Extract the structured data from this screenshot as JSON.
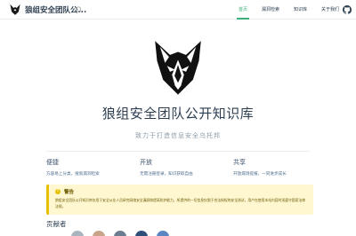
{
  "header": {
    "site_name": "狼组安全团队公...",
    "nav": [
      {
        "label": "首页",
        "active": true
      },
      {
        "label": "漏洞检索",
        "active": false
      },
      {
        "label": "知识库",
        "active": false
      },
      {
        "label": "关于我们",
        "active": false
      }
    ]
  },
  "hero": {
    "title": "狼组安全团队公开知识库",
    "description": "致力于打造信息安全乌托邦"
  },
  "features": [
    {
      "title": "便捷",
      "text": "方容易上分类，搜索漏洞检索"
    },
    {
      "title": "开放",
      "text": "无需注册登录，知识获取自由"
    },
    {
      "title": "共享",
      "text": "开放漏洞提报，一同进步成长"
    }
  ],
  "warning": {
    "icon": "!",
    "title": "警告",
    "text": "狼组安全团队公开知识库仅用于安全从业人员研究网络安全漏洞和提高防护能力，所提供的一切信息仅限于合法授权的安全测试，用户在使用本站内容时须遵守国家法律法规。"
  },
  "contributors": {
    "title": "贡献者",
    "avatar_colors": [
      "#a9b4bf",
      "#c9a48b",
      "#6b7d8e",
      "#2d4f7a",
      "#5b86c2"
    ]
  },
  "colors": {
    "accent": "#3eaf7c",
    "warning_border": "#e7c000",
    "warning_bg": "#fff7d0"
  }
}
